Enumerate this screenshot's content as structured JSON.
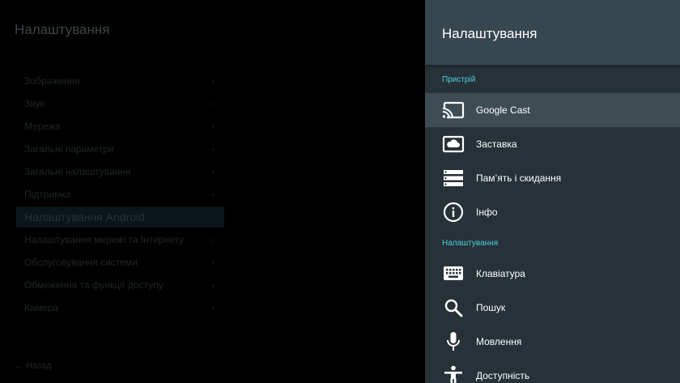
{
  "background": {
    "title": "Налаштування",
    "items": [
      {
        "label": "Зображення",
        "arrow": "›"
      },
      {
        "label": "Звук",
        "arrow": "›"
      },
      {
        "label": "Мережа",
        "arrow": "›"
      },
      {
        "label": "Загальні параметри",
        "arrow": "›"
      },
      {
        "label": "Загальні налаштування",
        "arrow": "›"
      },
      {
        "label": "Підтримка",
        "arrow": "›"
      }
    ],
    "selected_item": "Налаштування Android",
    "items_after": [
      {
        "label": "Налаштування мережі та Інтернету",
        "arrow": "›"
      },
      {
        "label": "Обслуговування системи",
        "arrow": "›"
      },
      {
        "label": "Обмеження та функції доступу",
        "arrow": "›"
      },
      {
        "label": "Камера",
        "arrow": "›"
      }
    ],
    "footer": "← Назад"
  },
  "panel": {
    "title": "Налаштування",
    "sections": [
      {
        "label": "Пристрій",
        "items": [
          {
            "label": "Google Cast",
            "icon": "cast-icon"
          },
          {
            "label": "Заставка",
            "icon": "screensaver-icon"
          },
          {
            "label": "Пам’ять і скидання",
            "icon": "storage-icon"
          },
          {
            "label": "Інфо",
            "icon": "info-icon"
          }
        ]
      },
      {
        "label": "Налаштування",
        "items": [
          {
            "label": "Клавіатура",
            "icon": "keyboard-icon"
          },
          {
            "label": "Пошук",
            "icon": "search-icon"
          },
          {
            "label": "Мовлення",
            "icon": "microphone-icon"
          },
          {
            "label": "Доступність",
            "icon": "accessibility-icon"
          }
        ]
      }
    ],
    "focused_item": "Google Cast"
  },
  "colors": {
    "panel_bg": "#263238",
    "header_bg": "#37474f",
    "focused_bg": "#3e4d54",
    "section_accent": "#4dd0e1"
  }
}
